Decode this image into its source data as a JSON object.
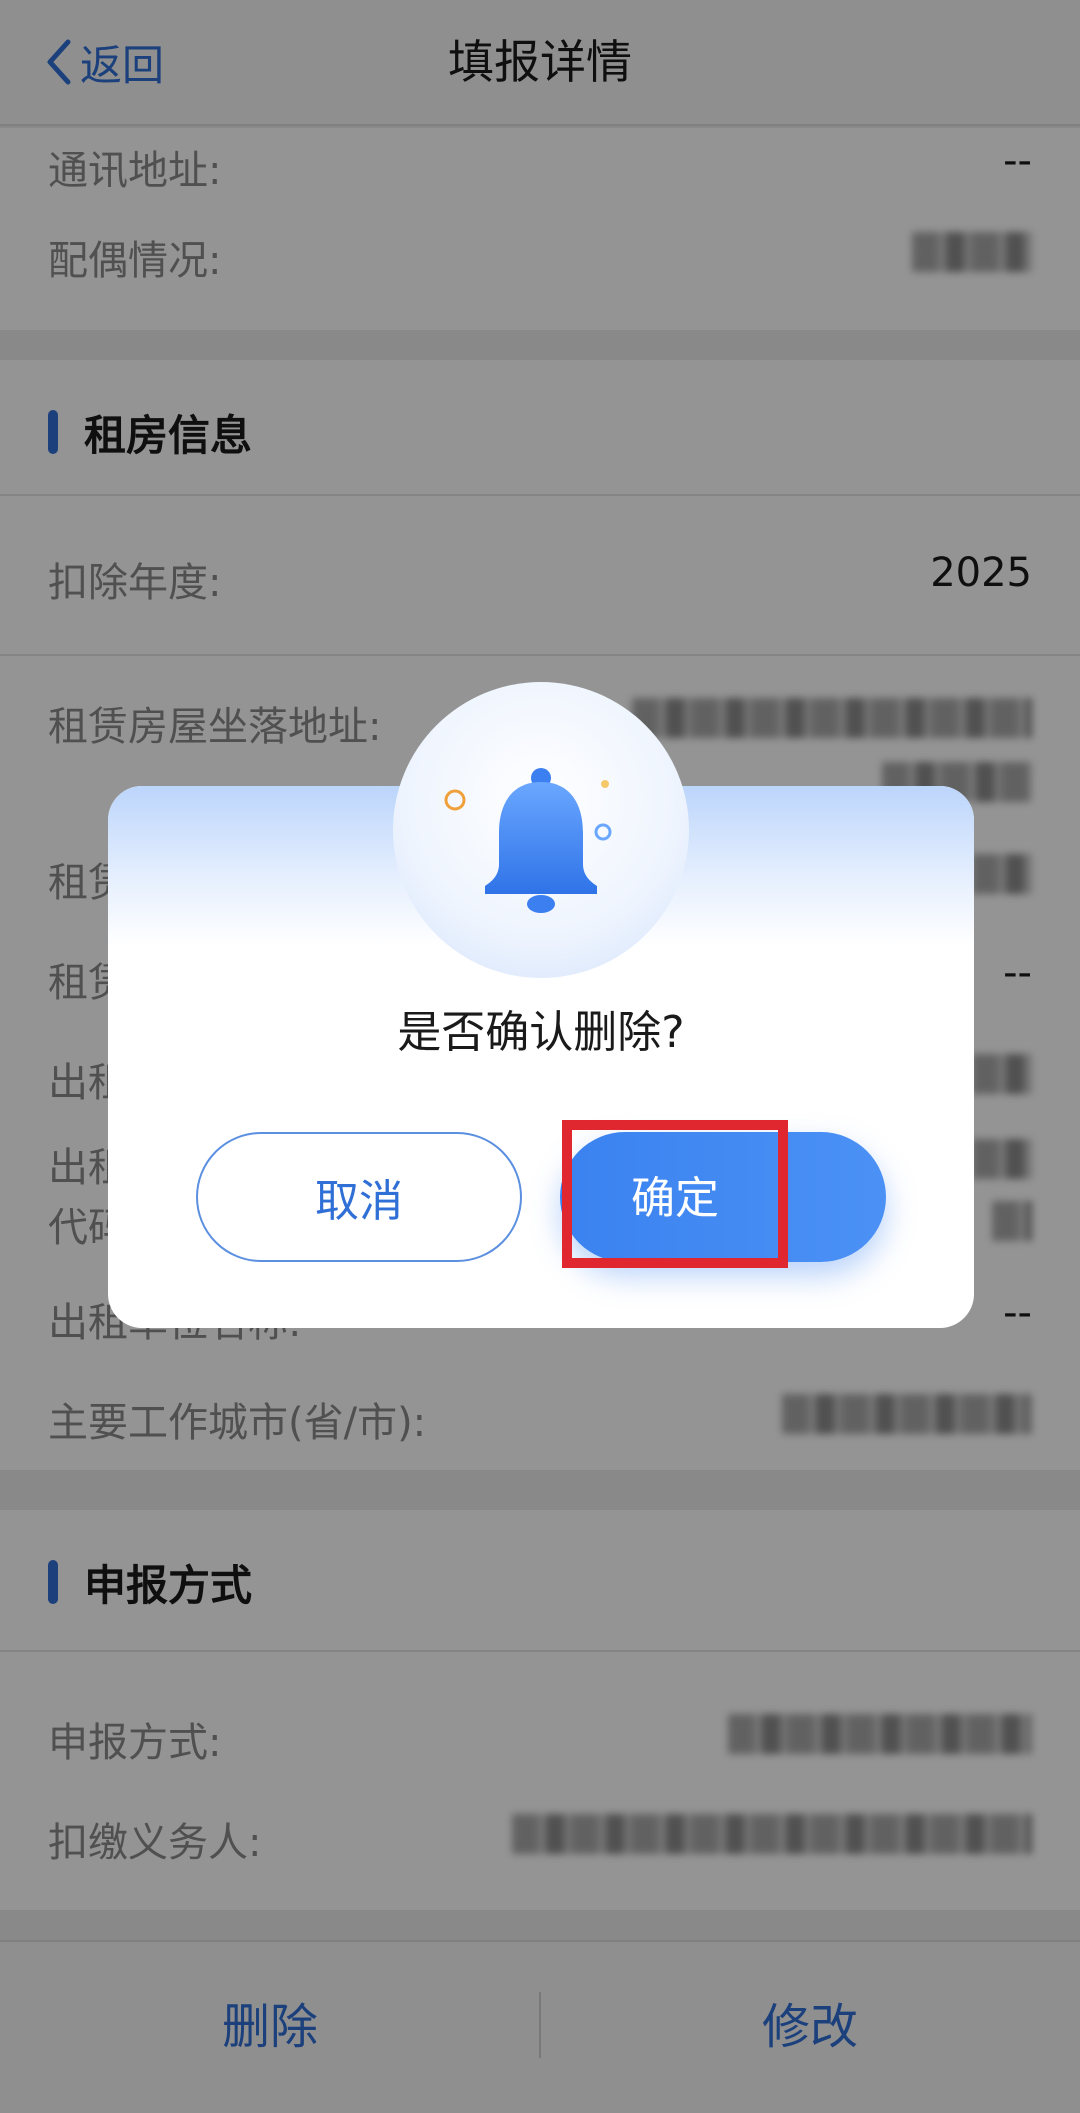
{
  "header": {
    "back_label": "返回",
    "title": "填报详情"
  },
  "personal": {
    "rows": [
      {
        "label": "通讯地址:",
        "value": "--"
      },
      {
        "label": "配偶情况:",
        "value": ""
      }
    ]
  },
  "rent": {
    "title": "租房信息",
    "rows": [
      {
        "label": "扣除年度:",
        "value": "2025"
      },
      {
        "label": "租赁房屋坐落地址:",
        "value": ""
      },
      {
        "label": "租赁",
        "value": ""
      },
      {
        "label": "租赁",
        "value": "--"
      },
      {
        "label": "出租",
        "value": ""
      },
      {
        "label": "出租",
        "label2": "代码",
        "value": ""
      },
      {
        "label": "出租单位名称:",
        "value": "--"
      },
      {
        "label": "主要工作城市(省/市):",
        "value": ""
      }
    ]
  },
  "report": {
    "title": "申报方式",
    "rows": [
      {
        "label": "申报方式:",
        "value": ""
      },
      {
        "label": "扣缴义务人:",
        "value": ""
      }
    ]
  },
  "bottom": {
    "delete_label": "删除",
    "edit_label": "修改"
  },
  "dialog": {
    "icon": "bell-icon",
    "question": "是否确认删除?",
    "cancel_label": "取消",
    "confirm_label": "确定",
    "highlight_color": "#e0262f"
  }
}
